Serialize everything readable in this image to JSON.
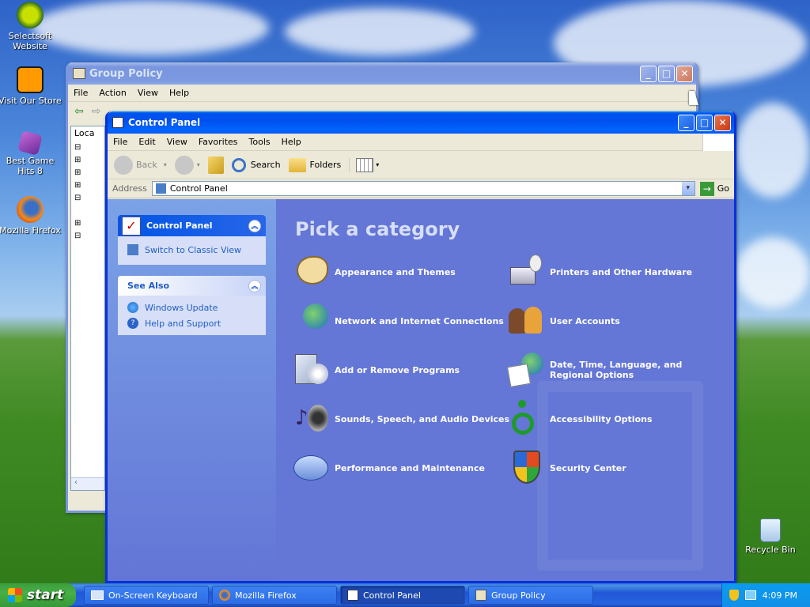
{
  "desktop": {
    "icons": [
      {
        "label": "Selectsoft Website",
        "icon": "selectsoft-icon"
      },
      {
        "label": "Visit Our Store",
        "icon": "store-icon"
      },
      {
        "label": "Best Game Hits 8",
        "icon": "game-dice-icon"
      },
      {
        "label": "Mozilla Firefox",
        "icon": "firefox-icon"
      },
      {
        "label": "Recycle Bin",
        "icon": "recycle-bin-icon"
      }
    ]
  },
  "group_policy": {
    "title": "Group Policy",
    "menu": [
      "File",
      "Action",
      "View",
      "Help"
    ],
    "tree_root": "Loca"
  },
  "control_panel": {
    "title": "Control Panel",
    "menu": [
      "File",
      "Edit",
      "View",
      "Favorites",
      "Tools",
      "Help"
    ],
    "toolbar": {
      "back": "Back",
      "search": "Search",
      "folders": "Folders"
    },
    "address": {
      "label": "Address",
      "value": "Control Panel",
      "go": "Go"
    },
    "sidebar": {
      "panel_title": "Control Panel",
      "switch_link": "Switch to Classic View",
      "see_also_title": "See Also",
      "see_also": [
        "Windows Update",
        "Help and Support"
      ]
    },
    "heading": "Pick a category",
    "categories_left": [
      "Appearance and Themes",
      "Network and Internet Connections",
      "Add or Remove Programs",
      "Sounds, Speech, and Audio Devices",
      "Performance and Maintenance"
    ],
    "categories_right": [
      "Printers and Other Hardware",
      "User Accounts",
      "Date, Time, Language, and Regional Options",
      "Accessibility Options",
      "Security Center"
    ]
  },
  "taskbar": {
    "start": "start",
    "tasks": [
      "On-Screen Keyboard",
      "Mozilla Firefox",
      "Control Panel",
      "Group Policy"
    ],
    "clock": "4:09 PM"
  }
}
